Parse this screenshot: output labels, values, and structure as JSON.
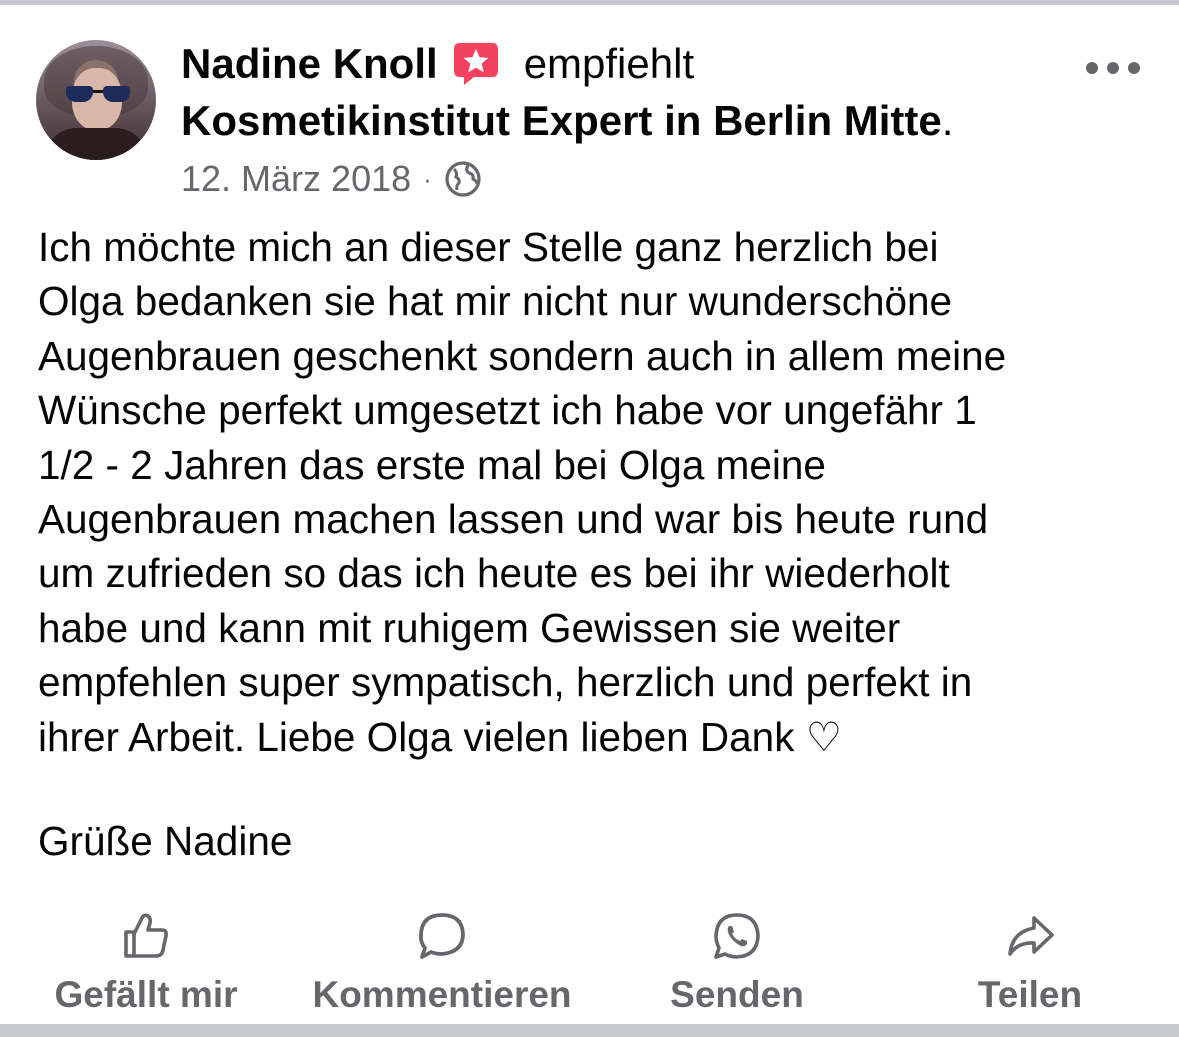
{
  "post": {
    "author": "Nadine Knoll",
    "verb": "empfiehlt",
    "page_name": "Kosmetikinstitut Expert in Berlin Mitte",
    "page_name_suffix": ".",
    "date": "12. März 2018",
    "separator": "·",
    "audience_icon": "globe-icon",
    "recommend_icon": "recommendation-star-icon",
    "more_icon": "more-options-icon",
    "body_lines": [
      "Ich möchte mich an dieser Stelle ganz herzlich bei",
      "Olga bedanken sie hat mir nicht nur wunderschöne",
      "Augenbrauen geschenkt sondern auch in allem meine",
      "Wünsche perfekt umgesetzt ich habe vor ungefähr 1",
      "1/2 - 2 Jahren das erste mal bei Olga meine",
      "Augenbrauen machen lassen und war bis heute rund",
      "um zufrieden so das ich heute es bei ihr wiederholt",
      "habe und kann mit ruhigem Gewissen sie weiter",
      "empfehlen super sympatisch, herzlich und perfekt in",
      "ihrer Arbeit. Liebe Olga vielen lieben Dank ♡"
    ],
    "greeting": "Grüße Nadine"
  },
  "actions": {
    "like": "Gefällt mir",
    "comment": "Kommentieren",
    "send": "Senden",
    "share": "Teilen"
  },
  "colors": {
    "text": "#050505",
    "secondary": "#65676b",
    "recommend_badge": "#f3425f",
    "separator": "#c8c9cd"
  }
}
